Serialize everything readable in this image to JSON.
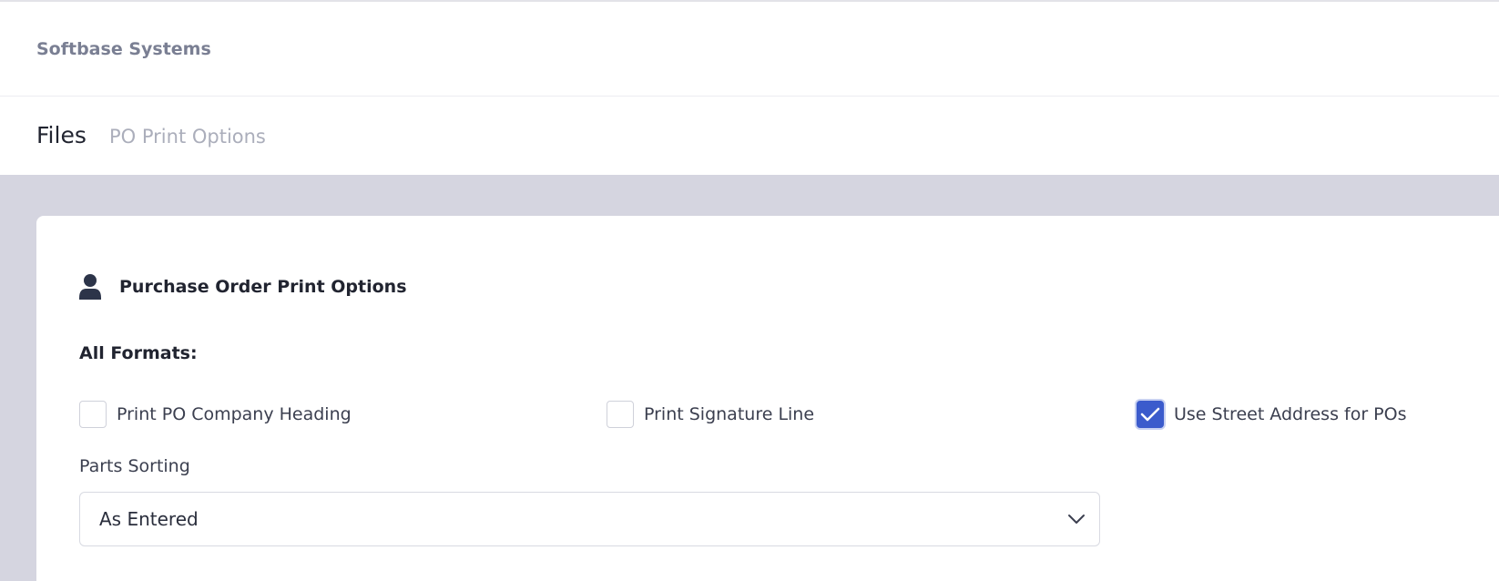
{
  "company": {
    "name": "Softbase Systems"
  },
  "breadcrumb": {
    "main": "Files",
    "sub": "PO Print Options"
  },
  "card": {
    "title": "Purchase Order Print Options",
    "icon": "user-icon",
    "section_label": "All Formats:"
  },
  "options": [
    {
      "label": "Print PO Company Heading",
      "checked": false
    },
    {
      "label": "Print Signature Line",
      "checked": false
    },
    {
      "label": "Use Street Address for POs",
      "checked": true
    }
  ],
  "parts_sorting": {
    "label": "Parts Sorting",
    "value": "As Entered"
  },
  "colors": {
    "accent": "#3b5bcc",
    "page_bg": "#d5d5e0"
  }
}
